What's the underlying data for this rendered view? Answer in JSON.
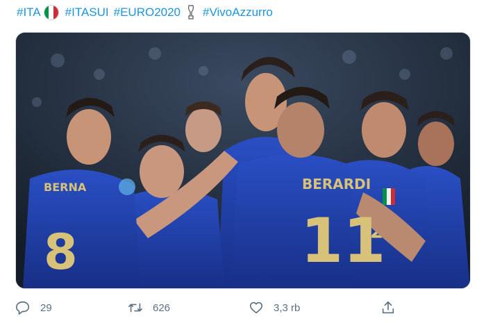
{
  "tweet": {
    "hashtags": [
      "#ITA",
      "#ITASUI",
      "#EURO2020",
      "#VivoAzzurro"
    ],
    "flag_colors": [
      "#009246",
      "#ffffff",
      "#ce2b37"
    ],
    "media": {
      "jersey_name": "BERARDI",
      "jersey_number": "11",
      "left_player_name": "BERNA",
      "left_player_number": "8",
      "right_player_number": "22"
    },
    "actions": {
      "reply_icon": "reply-icon",
      "reply_count": "29",
      "retweet_icon": "retweet-icon",
      "retweet_count": "626",
      "like_icon": "heart-icon",
      "like_count": "3,3 rb",
      "share_icon": "share-icon"
    },
    "colors": {
      "link": "#1b95e0",
      "action_gray": "#5b7083",
      "kit_blue": "#1e3fa8"
    }
  }
}
